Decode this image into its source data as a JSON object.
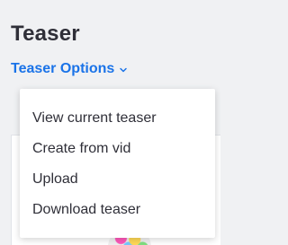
{
  "header": {
    "title": "Teaser",
    "options_label": "Teaser Options"
  },
  "menu": {
    "items": [
      {
        "label": "View current teaser"
      },
      {
        "label": "Create from vid"
      },
      {
        "label": "Upload"
      },
      {
        "label": "Download teaser"
      }
    ]
  },
  "icons": {
    "options_chevron": "chevron-down-icon"
  },
  "colors": {
    "accent": "#1a73e8",
    "text": "#2f2f38",
    "background": "#f0f1f3",
    "menu_background": "#ffffff"
  }
}
